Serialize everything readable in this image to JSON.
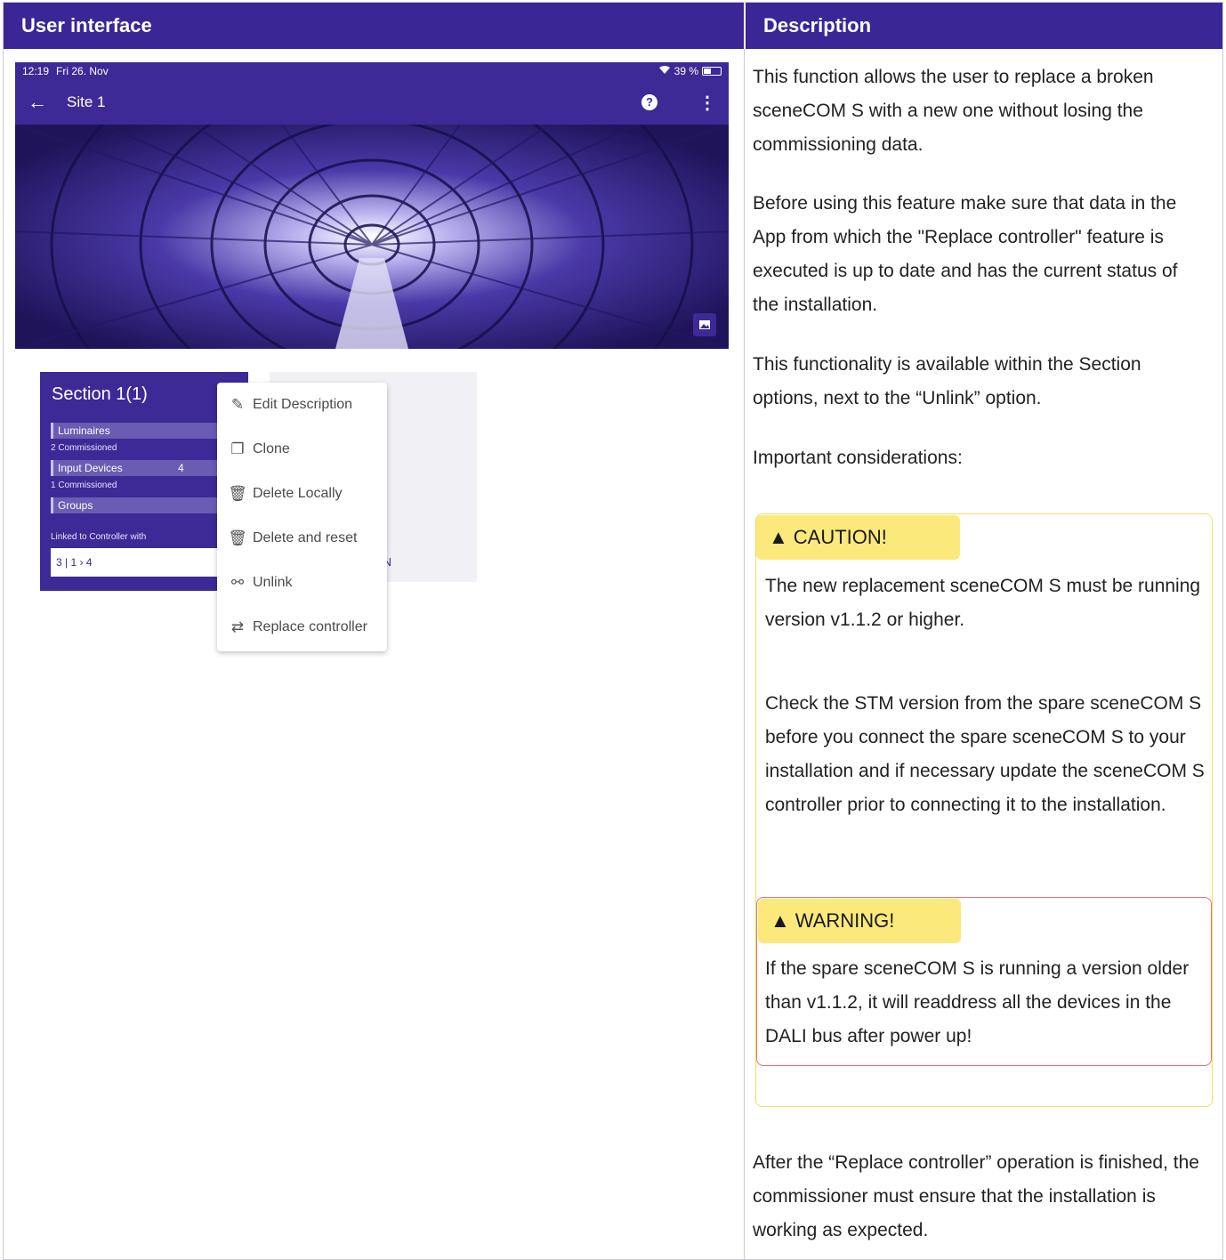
{
  "table": {
    "col_ui_header": "User interface",
    "col_desc_header": "Description"
  },
  "status_bar": {
    "time": "12:19",
    "date": "Fri 26. Nov",
    "battery": "39 %"
  },
  "app_bar": {
    "title": "Site 1",
    "back_icon": "arrow-left-icon",
    "help_icon": "help-icon",
    "more_icon": "more-vert-icon"
  },
  "section_card": {
    "title": "Section 1(1)",
    "rows": [
      {
        "label": "Luminaires",
        "sub": "2 Commissioned"
      },
      {
        "label": "Input Devices",
        "extra": "4",
        "sub": "1 Commissioned"
      },
      {
        "label": "Groups"
      }
    ],
    "linked_label": "Linked to Controller with",
    "linked_counts": "3 |   1 ›   4"
  },
  "ghost_action": "TION",
  "menu": {
    "items": [
      {
        "label": "Edit Description",
        "icon": "edit-icon"
      },
      {
        "label": "Clone",
        "icon": "clone-icon"
      },
      {
        "label": "Delete Locally",
        "icon": "trash-icon"
      },
      {
        "label": "Delete and reset",
        "icon": "trash-reset-icon"
      },
      {
        "label": "Unlink",
        "icon": "unlink-icon"
      },
      {
        "label": "Replace controller",
        "icon": "replace-icon"
      }
    ]
  },
  "description": {
    "p1": "This function allows the user to replace a broken sceneCOM S with a new one without losing the commissioning data.",
    "p2": "Before using this feature make sure that data in the App from which the \"Replace controller\" feature is executed is up to date and has the current status of the installation.",
    "p3": "This functionality is available within the Section options, next to the “Unlink” option.",
    "p4": "Important considerations:",
    "caution_label": "CAUTION!",
    "caution_text": "The new replacement sceneCOM S must be running version v1.1.2 or higher.",
    "caution_text2": "Check the STM version from the spare sceneCOM S before you connect the spare sceneCOM S to your installation and if necessary update the sceneCOM S controller prior to connecting it to the installation.",
    "warning_label": "WARNING!",
    "warning_text": "If the spare sceneCOM S is running a version older than v1.1.2, it will readdress all the devices in the DALI bus after power up!",
    "p5": "After the “Replace controller” operation is finished, the commissioner must ensure that the installation is working as expected."
  },
  "colors": {
    "header": "#3a2795",
    "app_primary": "#3d2a96",
    "caution_badge": "#fbe97b",
    "warning_border": "#e57373"
  }
}
